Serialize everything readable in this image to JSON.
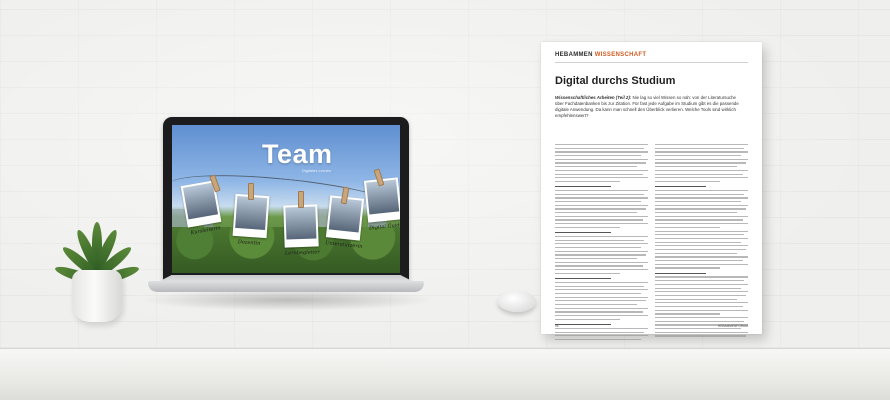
{
  "laptop_screen": {
    "brand_title": "Team",
    "brand_subtitle": "Digitales Lernen",
    "photo_captions": [
      "Kursleiterin",
      "Dozentin",
      "Lernbegleiter",
      "Unterstützerin",
      "Digital Guide"
    ]
  },
  "magazine": {
    "section": "HEBAMMEN",
    "section_accent": "WISSENSCHAFT",
    "title": "Digital durchs Studium",
    "lead_bold": "Wissenschaftliches Arbeiten (Teil 2):",
    "lead_text": "Nie lag so viel Wissen so nah: von der Literatursuche über Fachdatenbanken bis zur Zitation. Für fast jede Aufgabe im Studium gibt es die passende digitale Anwendung. Da kann man schnell den Überblick verlieren. Welche Tools sind wirklich empfehlenswert?",
    "page_number": "96",
    "footer_right": "HEBAMMENFORUM"
  },
  "colors": {
    "accent": "#d25a1e",
    "wall": "#efefed",
    "laptop_body": "#1c1c1e"
  }
}
